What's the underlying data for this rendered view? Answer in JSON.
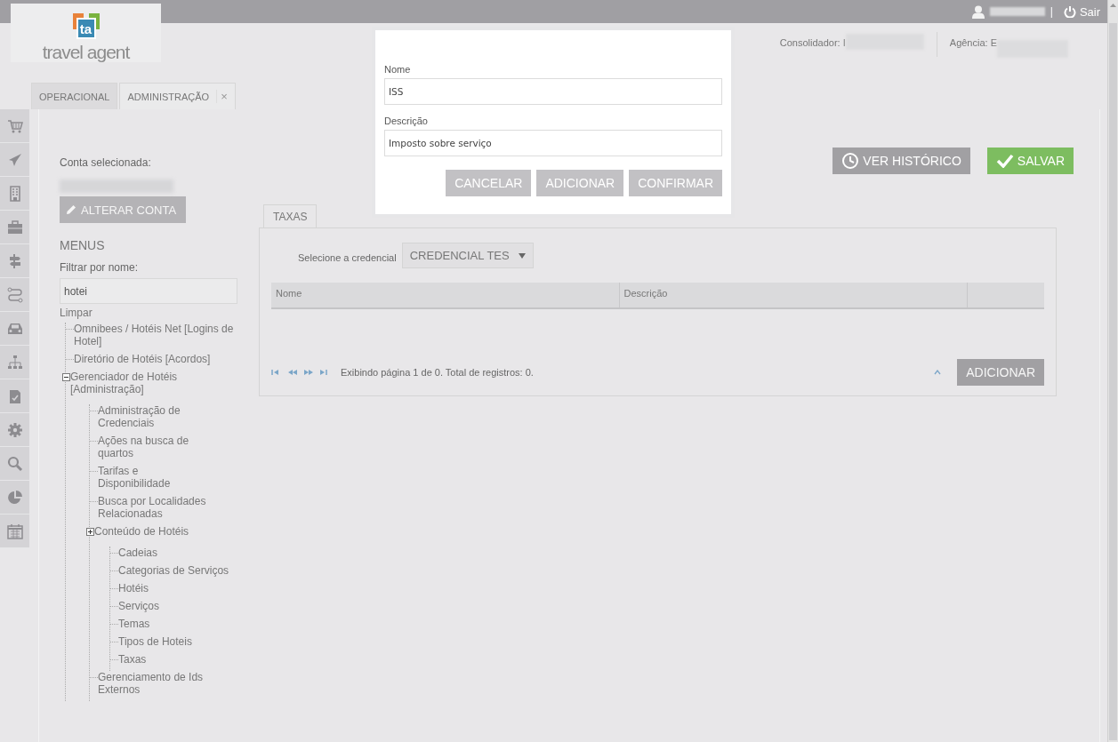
{
  "top_bar": {
    "separator": "|",
    "logout": "Sair"
  },
  "logo": {
    "mark": "ta",
    "text": "travel agent"
  },
  "header": {
    "consolidador": "Consolidador: I",
    "agencia": "Agência: E"
  },
  "tabs": [
    {
      "label": "OPERACIONAL",
      "selected": false
    },
    {
      "label": "ADMINISTRAÇÃO",
      "selected": true,
      "close": "×"
    }
  ],
  "account": {
    "label": "Conta selecionada:",
    "change_button": "ALTERAR CONTA"
  },
  "menus": {
    "title": "MENUS",
    "filter_label": "Filtrar por nome:",
    "filter_value": "hotei",
    "clear_link": "Limpar",
    "tree": [
      {
        "label": "Omnibees / Hotéis Net [Logins de Hotel]"
      },
      {
        "label": "Diretório de Hotéis [Acordos]"
      },
      {
        "label": "Gerenciador de Hotéis [Administração]",
        "expanded": true,
        "children": [
          {
            "label": "Administração de Credenciais"
          },
          {
            "label": "Ações na busca de quartos"
          },
          {
            "label": "Tarifas e Disponibilidade"
          },
          {
            "label": "Busca por Localidades Relacionadas"
          },
          {
            "label": "Conteúdo de Hotéis",
            "expanded": false,
            "children": [
              {
                "label": "Cadeias"
              },
              {
                "label": "Categorias de Serviços"
              },
              {
                "label": "Hotéis"
              },
              {
                "label": "Serviços"
              },
              {
                "label": "Temas"
              },
              {
                "label": "Tipos de Hoteis"
              },
              {
                "label": "Taxas"
              }
            ]
          },
          {
            "label": "Gerenciamento de Ids Externos"
          }
        ]
      }
    ]
  },
  "actions": [
    {
      "label": "VER HISTÓRICO",
      "kind": "history"
    },
    {
      "label": "SALVAR",
      "kind": "save"
    }
  ],
  "panel_tabs": [
    {
      "label": "TAXAS",
      "selected": true
    }
  ],
  "credential": {
    "label": "Selecione a credencial",
    "value": "CREDENCIAL TES"
  },
  "table": {
    "columns": [
      "Nome",
      "Descrição"
    ]
  },
  "pager": {
    "text": "Exibindo página 1 de 0. Total de registros: 0.",
    "add_button": "ADICIONAR"
  },
  "dialog": {
    "fields": [
      {
        "label": "Nome",
        "value": "ISS"
      },
      {
        "label": "Descrição",
        "value": "Imposto sobre serviço"
      }
    ],
    "buttons": [
      "CANCELAR",
      "ADICIONAR",
      "CONFIRMAR"
    ]
  }
}
